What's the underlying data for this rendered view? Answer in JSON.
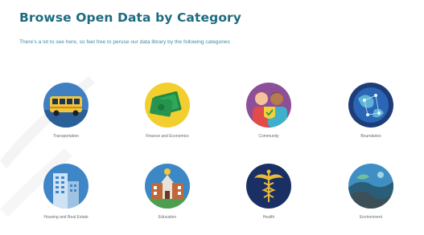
{
  "header": {
    "title": "Browse Open Data by Category",
    "subtitle": "There's a lot to see here, so feel free to peruse our data library by the following categories"
  },
  "categories": [
    {
      "label": "Transportation",
      "icon": "bus-icon"
    },
    {
      "label": "Finance and Economics",
      "icon": "money-icon"
    },
    {
      "label": "Community",
      "icon": "people-icon"
    },
    {
      "label": "Boundaries",
      "icon": "globe-icon"
    },
    {
      "label": "Housing and Real Estate",
      "icon": "buildings-icon"
    },
    {
      "label": "Education",
      "icon": "school-icon"
    },
    {
      "label": "Health",
      "icon": "caduceus-icon"
    },
    {
      "label": "Environment",
      "icon": "landscape-icon"
    }
  ],
  "colors": {
    "title": "#1f6b80",
    "subtitle": "#3c8ca3",
    "label": "#666a6e"
  }
}
